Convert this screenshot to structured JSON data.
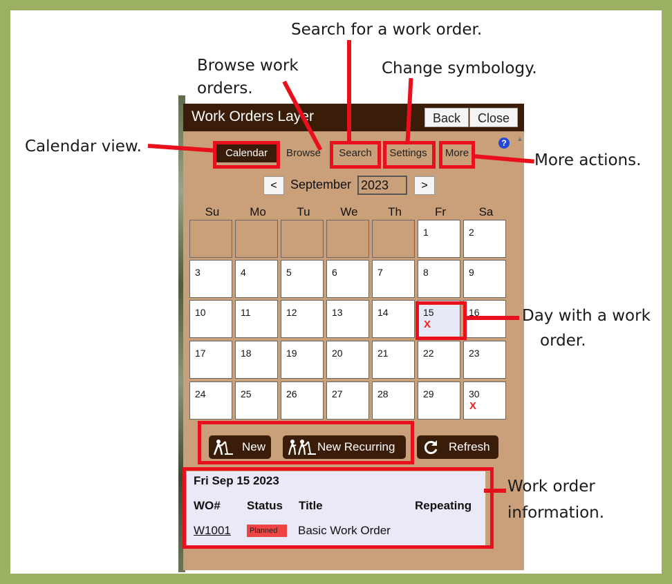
{
  "annotations": {
    "search": "Search for a work order.",
    "browse_line1": "Browse work",
    "browse_line2": "orders.",
    "symbology": "Change symbology.",
    "calendar": "Calendar view.",
    "more": "More actions.",
    "day_line1": "Day with a work",
    "day_line2": "order.",
    "info_line1": "Work order",
    "info_line2": "information."
  },
  "panel": {
    "title": "Work Orders Layer",
    "back_label": "Back",
    "close_label": "Close",
    "help_icon": "?"
  },
  "tabs": [
    {
      "label": "Calendar",
      "active": true
    },
    {
      "label": "Browse"
    },
    {
      "label": "Search"
    },
    {
      "label": "Settings"
    },
    {
      "label": "More"
    }
  ],
  "calendar": {
    "prev_label": "<",
    "next_label": ">",
    "month": "September",
    "year": "2023",
    "weekdays": [
      "Su",
      "Mo",
      "Tu",
      "We",
      "Th",
      "Fr",
      "Sa"
    ],
    "weeks": [
      [
        "",
        "",
        "",
        "",
        "",
        "1",
        "2"
      ],
      [
        "3",
        "4",
        "5",
        "6",
        "7",
        "8",
        "9"
      ],
      [
        "10",
        "11",
        "12",
        "13",
        "14",
        "15",
        "16"
      ],
      [
        "17",
        "18",
        "19",
        "20",
        "21",
        "22",
        "23"
      ],
      [
        "24",
        "25",
        "26",
        "27",
        "28",
        "29",
        "30"
      ]
    ],
    "work_order_days": [
      "15",
      "30"
    ],
    "work_order_marker": "X",
    "selected_day": "15"
  },
  "actions": {
    "new_label": "New",
    "new_recurring_label": "New Recurring",
    "refresh_label": "Refresh"
  },
  "work_order_info": {
    "date_heading": "Fri Sep 15 2023",
    "columns": [
      "WO#",
      "Status",
      "Title",
      "Repeating"
    ],
    "rows": [
      {
        "wo": "W1001",
        "status": "Planned",
        "title": "Basic Work Order",
        "repeating": ""
      }
    ]
  },
  "colors": {
    "annotation_red": "#e8101c",
    "panel_bg": "#c9a07a",
    "titlebar_bg": "#3a1d08",
    "status_planned": "#ee4444",
    "outer_border": "#9bb062"
  }
}
